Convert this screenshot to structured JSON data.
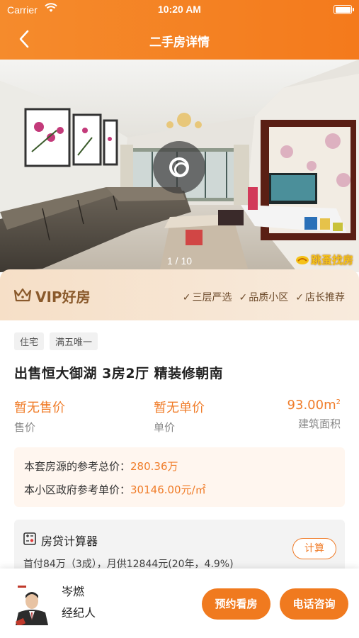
{
  "status_bar": {
    "carrier": "Carrier",
    "time": "10:20 AM"
  },
  "nav": {
    "title": "二手房详情",
    "back_icon": "chevron-left-icon"
  },
  "photo": {
    "counter": "1 / 10",
    "watermark": "跳蚤找房"
  },
  "vip": {
    "title": "VIP好房",
    "tags": [
      "三层严选",
      "品质小区",
      "店长推荐"
    ]
  },
  "listing": {
    "tags": [
      "住宅",
      "满五唯一"
    ],
    "title": "出售恒大御湖 3房2厅  精装修朝南",
    "price": {
      "value": "暂无售价",
      "label": "售价"
    },
    "unit_price": {
      "value": "暂无单价",
      "label": "单价"
    },
    "area": {
      "value": "93.00m",
      "unit_sup": "2",
      "label": "建筑面积"
    }
  },
  "reference": {
    "total_label": "本套房源的参考总价：",
    "total_value": "280.36万",
    "unit_label": "本小区政府参考单价：",
    "unit_value": "30146.00元/㎡"
  },
  "loan": {
    "title": "房贷计算器",
    "desc": "首付84万（3成），月供12844元(20年，4.9%)",
    "button": "计算"
  },
  "agent": {
    "name": "岑燃",
    "role": "经纪人",
    "view_button": "预约看房",
    "call_button": "电话咨询"
  },
  "colors": {
    "accent": "#f07a1f",
    "header": "#f47a1c",
    "vip_text": "#8a5a2c"
  }
}
